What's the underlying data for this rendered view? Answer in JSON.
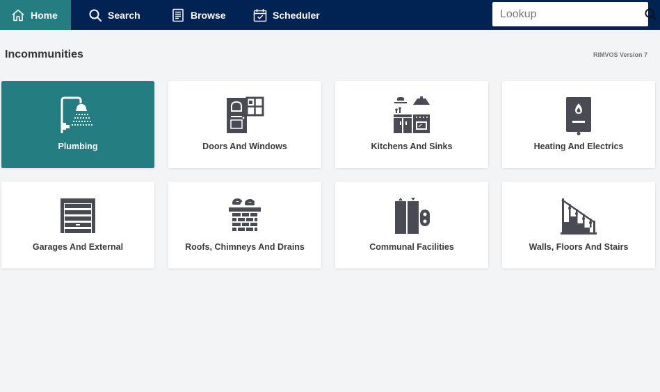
{
  "nav": {
    "home": {
      "label": "Home",
      "icon": "home-icon"
    },
    "search": {
      "label": "Search",
      "icon": "search-icon"
    },
    "browse": {
      "label": "Browse",
      "icon": "list-icon"
    },
    "scheduler": {
      "label": "Scheduler",
      "icon": "calendar-icon"
    }
  },
  "lookup": {
    "placeholder": "Lookup",
    "value": ""
  },
  "page": {
    "title": "Incommunities",
    "version": "RIMVOS Version 7"
  },
  "colors": {
    "nav_bg": "#012353",
    "accent": "#247d80",
    "icon": "#4a4a55"
  },
  "categories": [
    {
      "label": "Plumbing",
      "icon": "shower-icon",
      "selected": true
    },
    {
      "label": "Doors And Windows",
      "icon": "door-window-icon",
      "selected": false
    },
    {
      "label": "Kitchens And Sinks",
      "icon": "kitchen-icon",
      "selected": false
    },
    {
      "label": "Heating And Electrics",
      "icon": "boiler-icon",
      "selected": false
    },
    {
      "label": "Garages And External",
      "icon": "garage-icon",
      "selected": false
    },
    {
      "label": "Roofs, Chimneys And Drains",
      "icon": "chimney-icon",
      "selected": false
    },
    {
      "label": "Communal Facilities",
      "icon": "lift-icon",
      "selected": false
    },
    {
      "label": "Walls, Floors And Stairs",
      "icon": "stairs-icon",
      "selected": false
    }
  ]
}
